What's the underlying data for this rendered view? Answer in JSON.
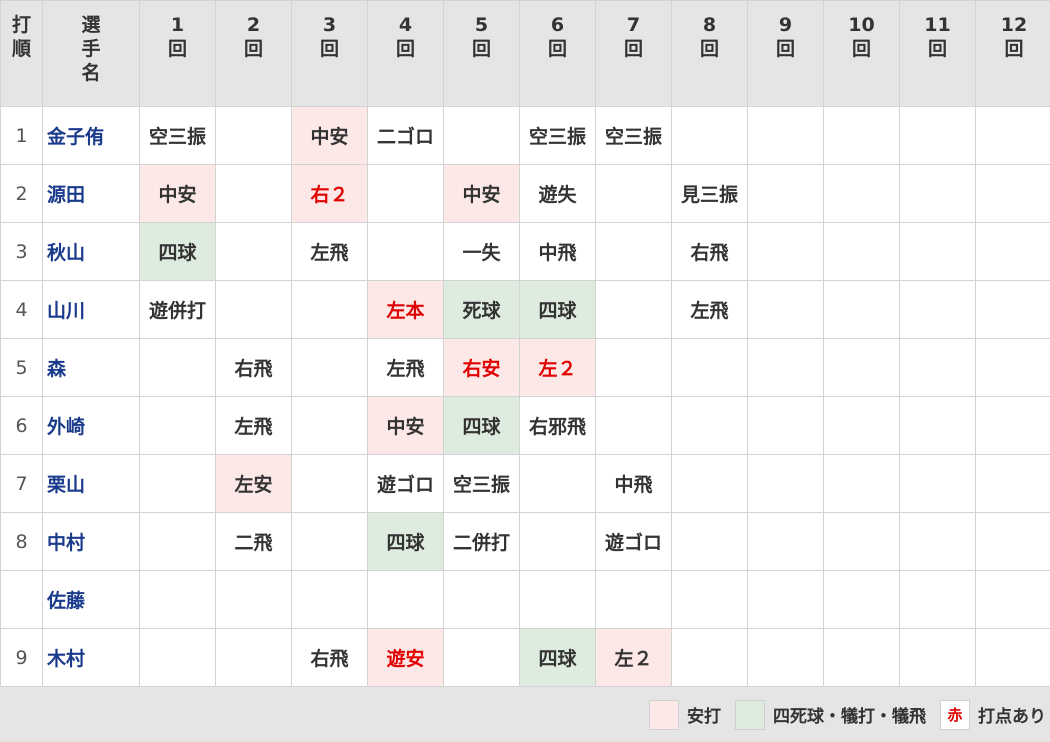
{
  "colors": {
    "hit": "#fde8e8",
    "walk": "#deebdf",
    "rbi": "#e00000",
    "name": "#1a3a8c",
    "header": "#e5e5e5"
  },
  "header": {
    "order": "打順",
    "name": "選手名",
    "innings": [
      {
        "num": "1",
        "unit": "回"
      },
      {
        "num": "2",
        "unit": "回"
      },
      {
        "num": "3",
        "unit": "回"
      },
      {
        "num": "4",
        "unit": "回"
      },
      {
        "num": "5",
        "unit": "回"
      },
      {
        "num": "6",
        "unit": "回"
      },
      {
        "num": "7",
        "unit": "回"
      },
      {
        "num": "8",
        "unit": "回"
      },
      {
        "num": "9",
        "unit": "回"
      },
      {
        "num": "10",
        "unit": "回"
      },
      {
        "num": "11",
        "unit": "回"
      },
      {
        "num": "12",
        "unit": "回"
      }
    ]
  },
  "rows": [
    {
      "order": "1",
      "name": "金子侑",
      "cells": [
        {
          "text": "空三振",
          "type": ""
        },
        {
          "text": "",
          "type": ""
        },
        {
          "text": "中安",
          "type": "hit"
        },
        {
          "text": "二ゴロ",
          "type": ""
        },
        {
          "text": "",
          "type": ""
        },
        {
          "text": "空三振",
          "type": ""
        },
        {
          "text": "空三振",
          "type": ""
        },
        {
          "text": "",
          "type": ""
        },
        {
          "text": "",
          "type": ""
        },
        {
          "text": "",
          "type": ""
        },
        {
          "text": "",
          "type": ""
        },
        {
          "text": "",
          "type": ""
        }
      ]
    },
    {
      "order": "2",
      "name": "源田",
      "cells": [
        {
          "text": "中安",
          "type": "hit"
        },
        {
          "text": "",
          "type": ""
        },
        {
          "text": "右２",
          "type": "hit rbi"
        },
        {
          "text": "",
          "type": ""
        },
        {
          "text": "中安",
          "type": "hit"
        },
        {
          "text": "遊失",
          "type": ""
        },
        {
          "text": "",
          "type": ""
        },
        {
          "text": "見三振",
          "type": ""
        },
        {
          "text": "",
          "type": ""
        },
        {
          "text": "",
          "type": ""
        },
        {
          "text": "",
          "type": ""
        },
        {
          "text": "",
          "type": ""
        }
      ]
    },
    {
      "order": "3",
      "name": "秋山",
      "cells": [
        {
          "text": "四球",
          "type": "walk"
        },
        {
          "text": "",
          "type": ""
        },
        {
          "text": "左飛",
          "type": ""
        },
        {
          "text": "",
          "type": ""
        },
        {
          "text": "一失",
          "type": ""
        },
        {
          "text": "中飛",
          "type": ""
        },
        {
          "text": "",
          "type": ""
        },
        {
          "text": "右飛",
          "type": ""
        },
        {
          "text": "",
          "type": ""
        },
        {
          "text": "",
          "type": ""
        },
        {
          "text": "",
          "type": ""
        },
        {
          "text": "",
          "type": ""
        }
      ]
    },
    {
      "order": "4",
      "name": "山川",
      "cells": [
        {
          "text": "遊併打",
          "type": ""
        },
        {
          "text": "",
          "type": ""
        },
        {
          "text": "",
          "type": ""
        },
        {
          "text": "左本",
          "type": "hit rbi"
        },
        {
          "text": "死球",
          "type": "walk"
        },
        {
          "text": "四球",
          "type": "walk"
        },
        {
          "text": "",
          "type": ""
        },
        {
          "text": "左飛",
          "type": ""
        },
        {
          "text": "",
          "type": ""
        },
        {
          "text": "",
          "type": ""
        },
        {
          "text": "",
          "type": ""
        },
        {
          "text": "",
          "type": ""
        }
      ]
    },
    {
      "order": "5",
      "name": "森",
      "cells": [
        {
          "text": "",
          "type": ""
        },
        {
          "text": "右飛",
          "type": ""
        },
        {
          "text": "",
          "type": ""
        },
        {
          "text": "左飛",
          "type": ""
        },
        {
          "text": "右安",
          "type": "hit rbi"
        },
        {
          "text": "左２",
          "type": "hit rbi"
        },
        {
          "text": "",
          "type": ""
        },
        {
          "text": "",
          "type": ""
        },
        {
          "text": "",
          "type": ""
        },
        {
          "text": "",
          "type": ""
        },
        {
          "text": "",
          "type": ""
        },
        {
          "text": "",
          "type": ""
        }
      ]
    },
    {
      "order": "6",
      "name": "外崎",
      "cells": [
        {
          "text": "",
          "type": ""
        },
        {
          "text": "左飛",
          "type": ""
        },
        {
          "text": "",
          "type": ""
        },
        {
          "text": "中安",
          "type": "hit"
        },
        {
          "text": "四球",
          "type": "walk"
        },
        {
          "text": "右邪飛",
          "type": ""
        },
        {
          "text": "",
          "type": ""
        },
        {
          "text": "",
          "type": ""
        },
        {
          "text": "",
          "type": ""
        },
        {
          "text": "",
          "type": ""
        },
        {
          "text": "",
          "type": ""
        },
        {
          "text": "",
          "type": ""
        }
      ]
    },
    {
      "order": "7",
      "name": "栗山",
      "cells": [
        {
          "text": "",
          "type": ""
        },
        {
          "text": "左安",
          "type": "hit"
        },
        {
          "text": "",
          "type": ""
        },
        {
          "text": "遊ゴロ",
          "type": ""
        },
        {
          "text": "空三振",
          "type": ""
        },
        {
          "text": "",
          "type": ""
        },
        {
          "text": "中飛",
          "type": ""
        },
        {
          "text": "",
          "type": ""
        },
        {
          "text": "",
          "type": ""
        },
        {
          "text": "",
          "type": ""
        },
        {
          "text": "",
          "type": ""
        },
        {
          "text": "",
          "type": ""
        }
      ]
    },
    {
      "order": "8",
      "name": "中村",
      "cells": [
        {
          "text": "",
          "type": ""
        },
        {
          "text": "二飛",
          "type": ""
        },
        {
          "text": "",
          "type": ""
        },
        {
          "text": "四球",
          "type": "walk"
        },
        {
          "text": "二併打",
          "type": ""
        },
        {
          "text": "",
          "type": ""
        },
        {
          "text": "遊ゴロ",
          "type": ""
        },
        {
          "text": "",
          "type": ""
        },
        {
          "text": "",
          "type": ""
        },
        {
          "text": "",
          "type": ""
        },
        {
          "text": "",
          "type": ""
        },
        {
          "text": "",
          "type": ""
        }
      ]
    },
    {
      "order": "",
      "name": "佐藤",
      "cells": [
        {
          "text": "",
          "type": ""
        },
        {
          "text": "",
          "type": ""
        },
        {
          "text": "",
          "type": ""
        },
        {
          "text": "",
          "type": ""
        },
        {
          "text": "",
          "type": ""
        },
        {
          "text": "",
          "type": ""
        },
        {
          "text": "",
          "type": ""
        },
        {
          "text": "",
          "type": ""
        },
        {
          "text": "",
          "type": ""
        },
        {
          "text": "",
          "type": ""
        },
        {
          "text": "",
          "type": ""
        },
        {
          "text": "",
          "type": ""
        }
      ]
    },
    {
      "order": "9",
      "name": "木村",
      "cells": [
        {
          "text": "",
          "type": ""
        },
        {
          "text": "",
          "type": ""
        },
        {
          "text": "右飛",
          "type": ""
        },
        {
          "text": "遊安",
          "type": "hit rbi"
        },
        {
          "text": "",
          "type": ""
        },
        {
          "text": "四球",
          "type": "walk"
        },
        {
          "text": "左２",
          "type": "hit"
        },
        {
          "text": "",
          "type": ""
        },
        {
          "text": "",
          "type": ""
        },
        {
          "text": "",
          "type": ""
        },
        {
          "text": "",
          "type": ""
        },
        {
          "text": "",
          "type": ""
        }
      ]
    }
  ],
  "legend": {
    "hit_label": "安打",
    "walk_label": "四死球・犠打・犠飛",
    "rbi_swatch": "赤",
    "rbi_label": "打点あり"
  }
}
